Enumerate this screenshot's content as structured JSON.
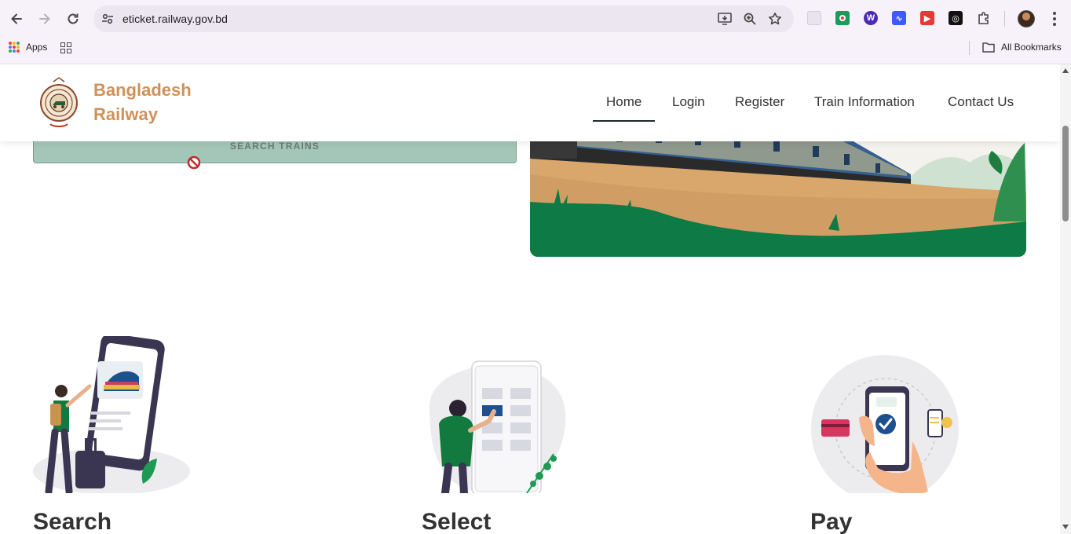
{
  "browser": {
    "url": "eticket.railway.gov.bd",
    "bookmarks": {
      "apps_label": "Apps",
      "all_bookmarks_label": "All Bookmarks"
    }
  },
  "site": {
    "brand_line1": "Bangladesh",
    "brand_line2": "Railway",
    "nav": [
      {
        "label": "Home",
        "active": true
      },
      {
        "label": "Login"
      },
      {
        "label": "Register"
      },
      {
        "label": "Train Information"
      },
      {
        "label": "Contact Us"
      }
    ],
    "search_button": "SEARCH TRAINS",
    "steps": [
      {
        "title": "Search"
      },
      {
        "title": "Select"
      },
      {
        "title": "Pay"
      }
    ]
  },
  "colors": {
    "brand": "#d0915a",
    "search_button_bg": "#a4c6b9",
    "hero_green": "#0e7a45",
    "train_blue": "#3b6ea5"
  }
}
